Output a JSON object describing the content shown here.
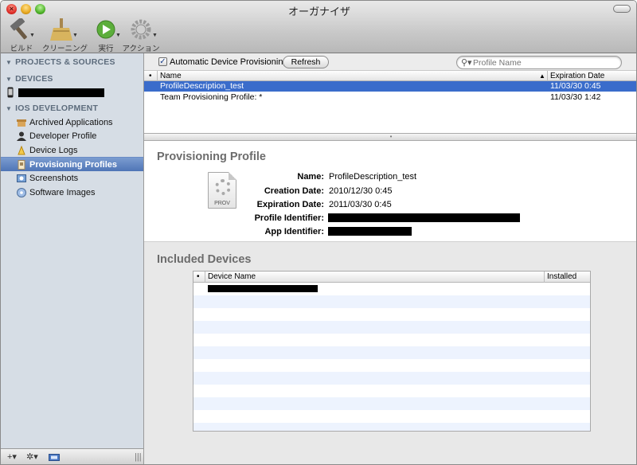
{
  "window": {
    "title": "オーガナイザ"
  },
  "toolbar": {
    "items": [
      {
        "label": "ビルド",
        "icon": "hammer-icon"
      },
      {
        "label": "クリーニング",
        "icon": "broom-icon"
      },
      {
        "label": "実行",
        "icon": "run-icon"
      },
      {
        "label": "アクション",
        "icon": "gear-icon"
      }
    ]
  },
  "sidebar": {
    "sections": {
      "projects": "PROJECTS & SOURCES",
      "devices": "DEVICES",
      "ios": "IOS DEVELOPMENT"
    },
    "items": [
      {
        "label": "Archived Applications",
        "icon": "archive-icon"
      },
      {
        "label": "Developer Profile",
        "icon": "person-icon"
      },
      {
        "label": "Device Logs",
        "icon": "log-icon"
      },
      {
        "label": "Provisioning Profiles",
        "icon": "profile-icon"
      },
      {
        "label": "Screenshots",
        "icon": "screenshot-icon"
      },
      {
        "label": "Software Images",
        "icon": "software-icon"
      }
    ],
    "footer": {
      "add": "+▾",
      "action": "✲▾"
    }
  },
  "list": {
    "auto_provisioning_label": "Automatic Device Provisioning",
    "auto_provisioning_checked": true,
    "refresh_label": "Refresh",
    "search_placeholder": "Profile Name",
    "columns": {
      "bullet": "•",
      "name": "Name",
      "expiration": "Expiration Date",
      "sort_indicator": "▲"
    },
    "rows": [
      {
        "name": "ProfileDescription_test",
        "expiration": "11/03/30 0:45",
        "selected": true
      },
      {
        "name": "Team Provisioning Profile: *",
        "expiration": "11/03/30 1:42",
        "selected": false
      }
    ]
  },
  "detail": {
    "heading": "Provisioning Profile",
    "icon_label": "PROV",
    "fields": [
      {
        "key": "Name:",
        "value": "ProfileDescription_test"
      },
      {
        "key": "Creation Date:",
        "value": "2010/12/30 0:45"
      },
      {
        "key": "Expiration Date:",
        "value": "2011/03/30 0:45"
      },
      {
        "key": "Profile Identifier:",
        "value": ""
      },
      {
        "key": "App Identifier:",
        "value": ""
      }
    ]
  },
  "devices": {
    "heading": "Included Devices",
    "columns": {
      "bullet": "•",
      "name": "Device Name",
      "installed": "Installed"
    }
  },
  "colors": {
    "selection": "#3a6ccb",
    "sidebar_bg": "#d6dde5",
    "sidebar_section": "#5d6c7c",
    "alt_row": "#edf3fe"
  }
}
